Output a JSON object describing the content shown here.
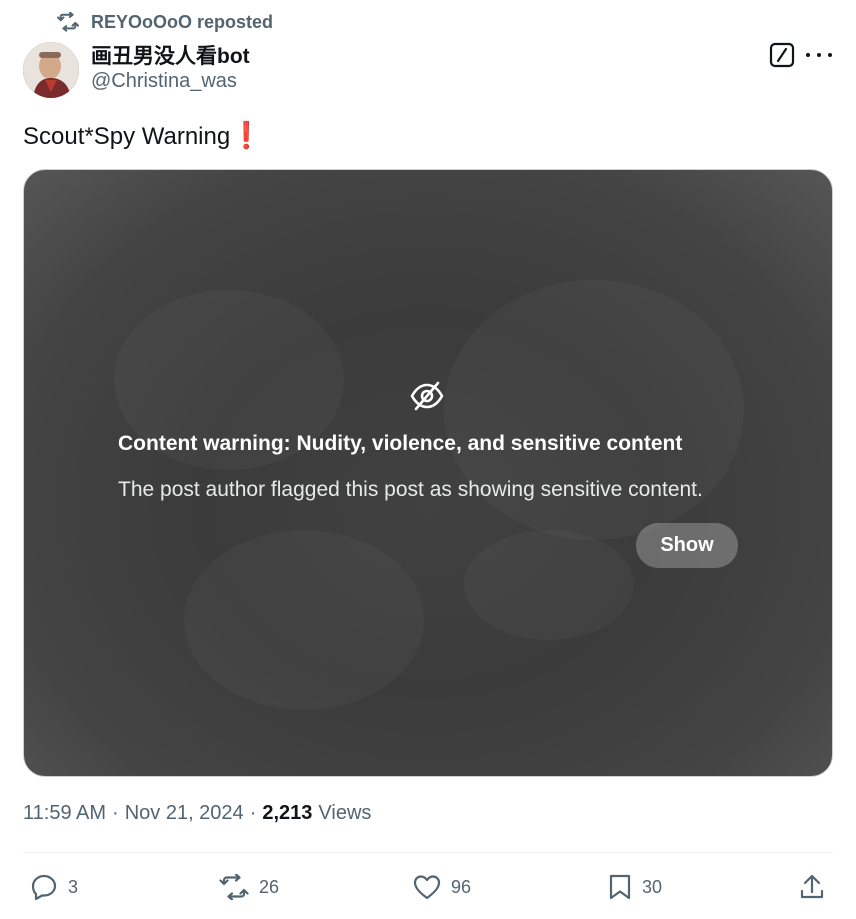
{
  "repost": {
    "label": "REYOoOoO reposted"
  },
  "author": {
    "display_name": "画丑男没人看bot",
    "handle": "@Christina_was"
  },
  "post": {
    "text": "Scout*Spy Warning",
    "emoji": "❗"
  },
  "media": {
    "warning_title": "Content warning: Nudity, violence, and sensitive content",
    "warning_description": "The post author flagged this post as showing sensitive content.",
    "show_label": "Show"
  },
  "meta": {
    "time": "11:59 AM",
    "date": "Nov 21, 2024",
    "separator": "·",
    "views_count": "2,213",
    "views_label": "Views"
  },
  "actions": {
    "replies": "3",
    "reposts": "26",
    "likes": "96",
    "bookmarks": "30"
  },
  "icons": [
    "repost-icon",
    "grok-icon",
    "more-icon",
    "eye-slash-icon",
    "reply-icon",
    "retweet-icon",
    "heart-icon",
    "bookmark-icon",
    "share-icon"
  ],
  "colors": {
    "text": "#0f1419",
    "secondary": "#536471",
    "warning_emoji": "#e0162b",
    "media_bg": "#3f3f3f"
  }
}
